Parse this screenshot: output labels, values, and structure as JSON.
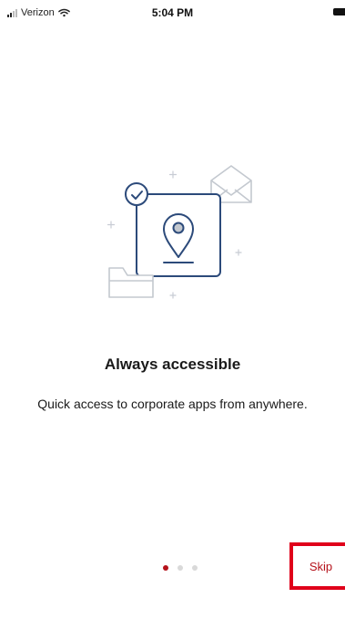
{
  "status_bar": {
    "carrier": "Verizon",
    "time": "5:04 PM"
  },
  "icons": {
    "signal": "signal-bars-icon",
    "wifi": "wifi-icon",
    "battery": "battery-icon",
    "illustration": [
      "location-pin-icon",
      "checkmark-badge-icon",
      "envelope-icon",
      "folder-icon"
    ]
  },
  "onboarding": {
    "title": "Always accessible",
    "subtitle": "Quick access to corporate apps from anywhere.",
    "pager": {
      "count": 3,
      "active_index": 0
    },
    "skip_label": "Skip"
  },
  "colors": {
    "accent": "#b5121b",
    "illustration_stroke": "#2c4a7a",
    "highlight_border": "#e0001a"
  }
}
